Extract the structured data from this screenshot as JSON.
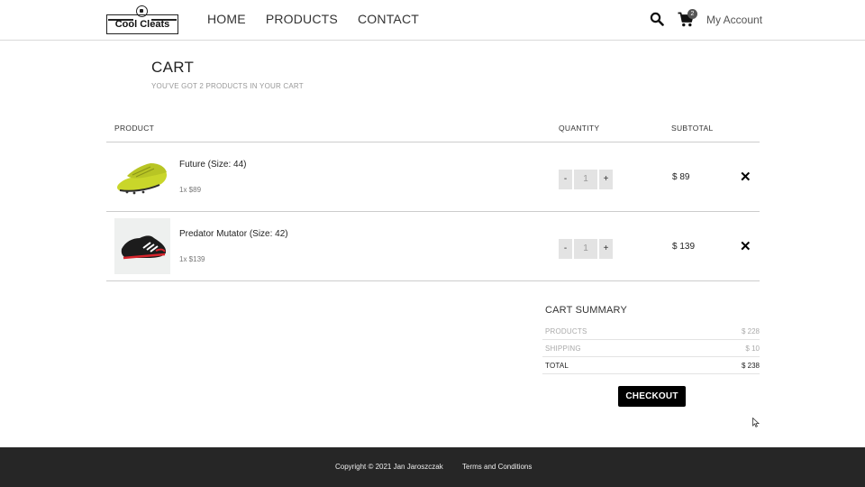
{
  "header": {
    "logo_text": "Cool Cleats",
    "nav": [
      "HOME",
      "PRODUCTS",
      "CONTACT"
    ],
    "cart_count": "2",
    "account": "My Account"
  },
  "cart": {
    "title": "CART",
    "subtitle": "YOU'VE GOT 2 PRODUCTS IN YOUR CART",
    "columns": {
      "product": "PRODUCT",
      "quantity": "QUANTITY",
      "subtotal": "SUBTOTAL"
    },
    "items": [
      {
        "name": "Future (Size: 44)",
        "price_line": "1x $89",
        "quantity": "1",
        "subtotal": "$ 89",
        "image": "yellow-football-boots"
      },
      {
        "name": "Predator Mutator (Size: 42)",
        "price_line": "1x $139",
        "quantity": "1",
        "subtotal": "$ 139",
        "image": "black-red-football-boot"
      }
    ],
    "qty_minus": "-",
    "qty_plus": "+",
    "remove_symbol": "✕"
  },
  "summary": {
    "title": "CART SUMMARY",
    "rows": [
      {
        "label": "PRODUCTS",
        "value": "$ 228"
      },
      {
        "label": "SHIPPING",
        "value": "$ 10"
      },
      {
        "label": "TOTAL",
        "value": "$ 238"
      }
    ],
    "checkout": "CHECKOUT"
  },
  "footer": {
    "copyright": "Copyright © 2021 Jan Jaroszczak",
    "terms": "Terms and Conditions"
  },
  "colors": {
    "accent": "#000000",
    "footer_bg": "#262626",
    "item1_shoe": "#c9d62a",
    "item2_shoe": "#1c1c1c",
    "item2_accent": "#d6242c"
  }
}
